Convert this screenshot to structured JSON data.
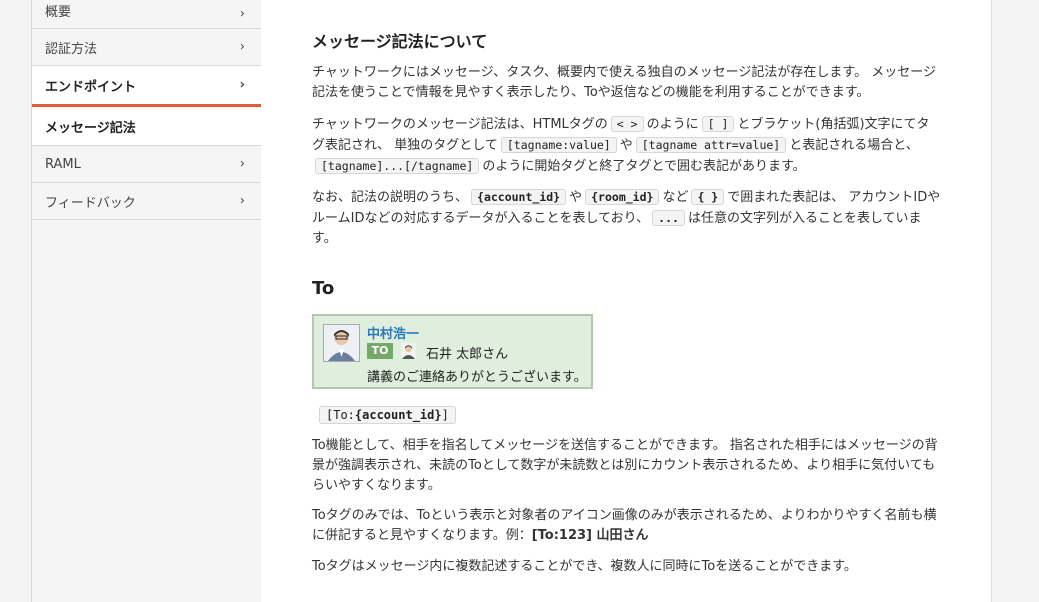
{
  "sidebar": {
    "items": [
      {
        "label": "概要",
        "chevron": "›"
      },
      {
        "label": "認証方法",
        "chevron": "›"
      },
      {
        "label": "エンドポイント",
        "chevron": "›"
      },
      {
        "label": "メッセージ記法"
      },
      {
        "label": "RAML",
        "chevron": "›"
      },
      {
        "label": "フィードバック",
        "chevron": "›"
      }
    ]
  },
  "article": {
    "title": "メッセージ記法について",
    "p1": "チャットワークにはメッセージ、タスク、概要内で使える独自のメッセージ記法が存在します。 メッセージ記法を使うことで情報を見やすく表示したり、Toや返信などの機能を利用することができます。",
    "p2": {
      "t1": "チャットワークのメッセージ記法は、HTMLタグの",
      "c1": "< >",
      "t2": "のように",
      "c2": "[ ]",
      "t3": "とブラケット(角括弧)文字にてタグ表記され、 単独のタグとして",
      "c3": "[tagname:value]",
      "t4": "や",
      "c4": "[tagname attr=value]",
      "t5": "と表記される場合と、",
      "c5": "[tagname]...[/tagname]",
      "t6": "のように開始タグと終了タグとで囲む表記があります。"
    },
    "p3": {
      "t1": "なお、記法の説明のうち、",
      "c1": "{account_id}",
      "t2": "や",
      "c2": "{room_id}",
      "t3": "など",
      "c3": "{ }",
      "t4": "で囲まれた表記は、 アカウントIDやルームIDなどの対応するデータが入ることを表しており、",
      "c4": "...",
      "t5": "は任意の文字列が入ることを表しています。"
    },
    "to_heading": "To",
    "example": {
      "sender": "中村浩一",
      "badge": "TO",
      "recipient": "石井 太郎さん",
      "message": "講義のご連絡ありがとうございます。",
      "sender_color": "#2a7ab8"
    },
    "code_prefix": "[To:",
    "code_bold": "{account_id}",
    "code_suffix": "]",
    "p4": "To機能として、相手を指名してメッセージを送信することができます。 指名された相手にはメッセージの背景が強調表示され、未読のToとして数字が未読数とは別にカウント表示されるため、より相手に気付いてもらいやすくなります。",
    "p5_text": "Toタグのみでは、Toという表示と対象者のアイコン画像のみが表示されるため、よりわかりやすく名前も横に併記すると見やすくなります。例：",
    "p5_bold": "[To:123] 山田さん",
    "p6": "Toタグはメッセージ内に複数記述することができ、複数人に同時にToを送ることができます。"
  },
  "colors": {
    "accent": "#e45b3c",
    "example_bg": "#dfeedd",
    "badge": "#74a96a"
  }
}
